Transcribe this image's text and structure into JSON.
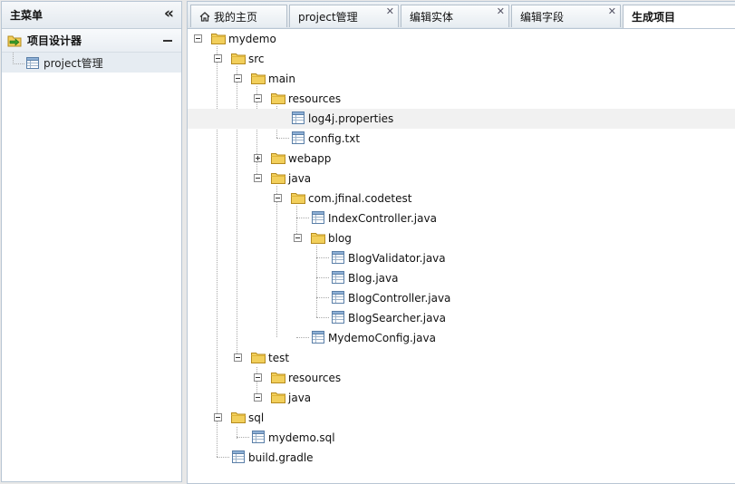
{
  "sidebar": {
    "title": "主菜单",
    "collapse_glyph": "«",
    "group": {
      "title": "项目设计器",
      "icon": "folder-arrow-icon"
    },
    "items": [
      {
        "label": "project管理",
        "icon": "table-icon"
      }
    ]
  },
  "tabs": [
    {
      "label": "我的主页",
      "icon": "home-icon",
      "closable": false,
      "active": false
    },
    {
      "label": "project管理",
      "closable": true,
      "active": false
    },
    {
      "label": "编辑实体",
      "closable": true,
      "active": false
    },
    {
      "label": "编辑字段",
      "closable": true,
      "active": false
    },
    {
      "label": "生成项目",
      "closable": false,
      "active": true
    }
  ],
  "tab_close_glyph": "✕",
  "tree": {
    "root": "mydemo",
    "src": "src",
    "main": "main",
    "main_resources": "resources",
    "log4j": "log4j.properties",
    "config": "config.txt",
    "webapp": "webapp",
    "java": "java",
    "package": "com.jfinal.codetest",
    "index_controller": "IndexController.java",
    "blog": "blog",
    "blog_validator": "BlogValidator.java",
    "blog_java": "Blog.java",
    "blog_controller": "BlogController.java",
    "blog_searcher": "BlogSearcher.java",
    "mydemo_config": "MydemoConfig.java",
    "test": "test",
    "test_resources": "resources",
    "test_java": "java",
    "sql": "sql",
    "mydemo_sql": "mydemo.sql",
    "build_gradle": "build.gradle"
  },
  "colors": {
    "border": "#b8c6d4",
    "folder": "#f2cf5b",
    "file_icon": "#5a7fa8",
    "row_highlight": "#f1f1f1"
  }
}
